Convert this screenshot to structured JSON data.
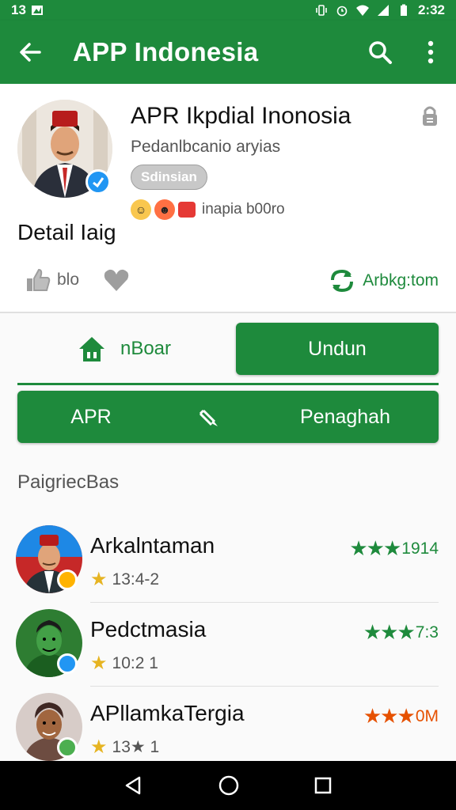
{
  "status_bar": {
    "left_text": "13",
    "time": "2:32"
  },
  "app_bar": {
    "title": "APP Indonesia"
  },
  "header": {
    "app_name": "APR Ikpdial Inonosia",
    "subtitle": "Pedanlbcanio aryias",
    "chip": "Sdinsian",
    "emoji_text": "inapia b00ro",
    "detail_label": "Detail Iaig",
    "like_text": "blo",
    "share_text": "Arbkg:tom"
  },
  "buttons": {
    "outline_label": "nBoar",
    "fill_label": "Undun"
  },
  "bar2": {
    "left_label": "APR",
    "right_label": "Penaghah"
  },
  "section": {
    "title": "PaigriecBas"
  },
  "list": [
    {
      "name": "Arkalntaman",
      "sub": "13:4-2",
      "rating_text": "1914",
      "star_color": "#1e8a3c",
      "badge_color": "#2196f3"
    },
    {
      "name": "Pedctmasia",
      "sub": "10:2 1",
      "rating_text": "7:3",
      "star_color": "#1e8a3c",
      "badge_color": "#2196f3"
    },
    {
      "name": "APllamkaTergia",
      "sub": "13★ 1",
      "rating_text": "0M",
      "star_color": "#e65100",
      "badge_color": "#4caf50"
    }
  ],
  "colors": {
    "primary": "#1e8a3c",
    "star_yellow": "#e6b422"
  }
}
